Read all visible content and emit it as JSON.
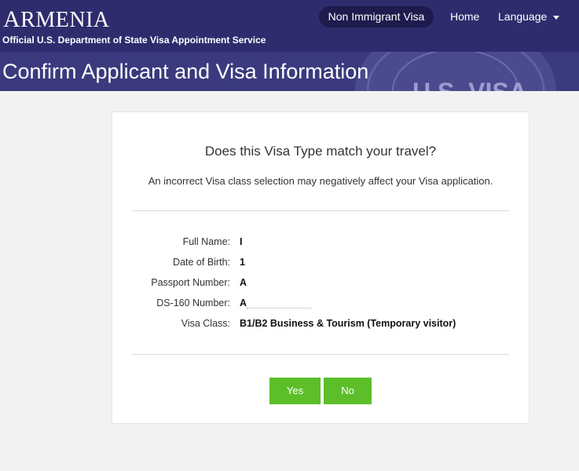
{
  "header": {
    "country_initial": "A",
    "country_rest": "RMENIA",
    "subtitle": "Official U.S. Department of State Visa Appointment Service",
    "nav": {
      "visa_type": "Non Immigrant Visa",
      "home": "Home",
      "language": "Language"
    }
  },
  "banner": {
    "title": "Confirm Applicant and Visa Information",
    "seal_text": "U.S. VISA"
  },
  "dialog": {
    "question": "Does this Visa Type match your travel?",
    "warning": "An incorrect Visa class selection may negatively affect your Visa application.",
    "fields": [
      {
        "label": "Full Name:",
        "value": "I"
      },
      {
        "label": "Date of Birth:",
        "value": "1"
      },
      {
        "label": "Passport Number:",
        "value": "A"
      },
      {
        "label": "DS-160 Number:",
        "value": "A"
      },
      {
        "label": "Visa Class:",
        "value": "B1/B2 Business & Tourism (Temporary visitor)"
      }
    ],
    "yes_label": "Yes",
    "no_label": "No"
  },
  "colors": {
    "header_bg": "#2f2c6e",
    "banner_bg": "#3c3a7e",
    "button_green": "#5cbf2a",
    "pill_bg": "#1e1b4d"
  }
}
